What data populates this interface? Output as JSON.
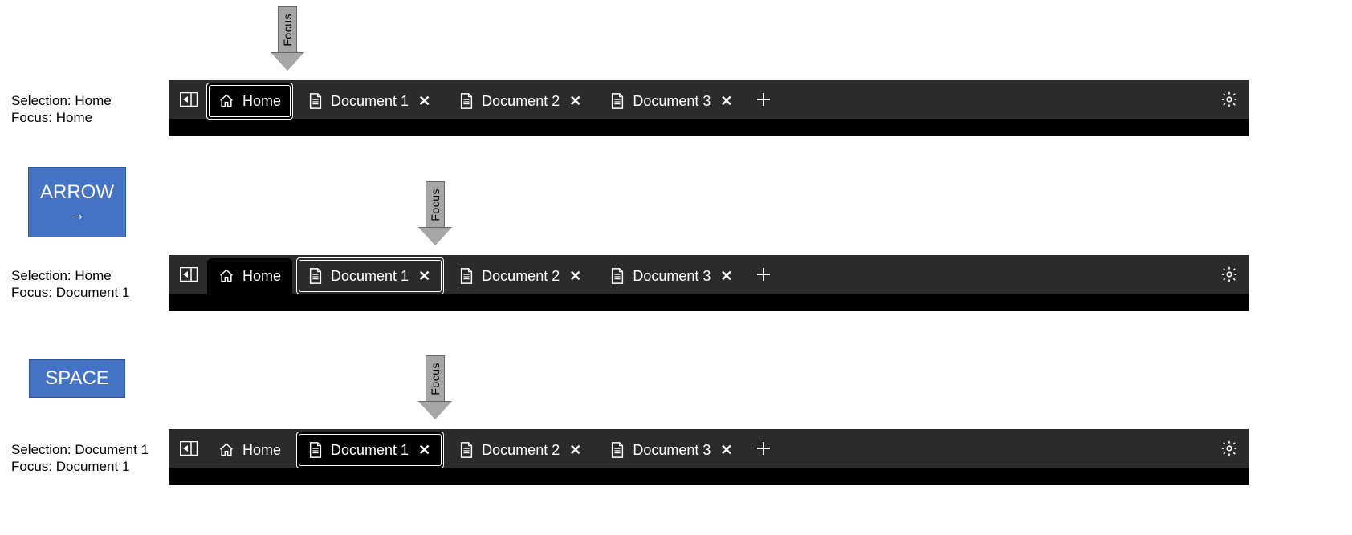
{
  "focus_arrow_label": "Focus",
  "keys": {
    "arrow_right": {
      "label": "ARROW",
      "glyph": "→"
    },
    "space": {
      "label": "SPACE"
    }
  },
  "states": [
    {
      "status_line1": "Selection: Home",
      "status_line2": "Focus: Home",
      "selected_index": 0,
      "focused_index": 0
    },
    {
      "status_line1": "Selection: Home",
      "status_line2": "Focus: Document 1",
      "selected_index": 0,
      "focused_index": 1
    },
    {
      "status_line1": "Selection: Document 1",
      "status_line2": "Focus: Document 1",
      "selected_index": 1,
      "focused_index": 1
    }
  ],
  "tabs": [
    {
      "label": "Home",
      "icon": "home",
      "closable": false
    },
    {
      "label": "Document 1",
      "icon": "doc",
      "closable": true
    },
    {
      "label": "Document 2",
      "icon": "doc",
      "closable": true
    },
    {
      "label": "Document 3",
      "icon": "doc",
      "closable": true
    }
  ],
  "icons": {
    "panel_button": "panel-collapse-icon",
    "add_tab": "plus-icon",
    "settings": "gear-icon",
    "close": "✕"
  }
}
